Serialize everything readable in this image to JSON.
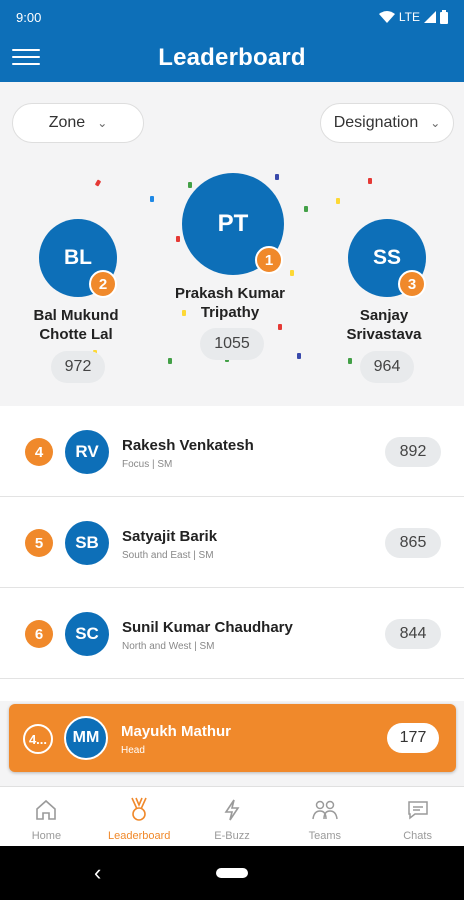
{
  "status_bar": {
    "time": "9:00",
    "network": "LTE"
  },
  "app_bar": {
    "title": "Leaderboard"
  },
  "filters": {
    "zone": "Zone",
    "designation": "Designation"
  },
  "podium": [
    {
      "rank": "1",
      "initials": "PT",
      "name_line1": "Prakash Kumar",
      "name_line2": "Tripathy",
      "score": "1055"
    },
    {
      "rank": "2",
      "initials": "BL",
      "name_line1": "Bal Mukund",
      "name_line2": "Chotte Lal",
      "score": "972"
    },
    {
      "rank": "3",
      "initials": "SS",
      "name_line1": "Sanjay",
      "name_line2": "Srivastava",
      "score": "964"
    }
  ],
  "list": [
    {
      "rank": "4",
      "initials": "RV",
      "name": "Rakesh Venkatesh",
      "sub": "Focus | SM",
      "score": "892"
    },
    {
      "rank": "5",
      "initials": "SB",
      "name": "Satyajit Barik",
      "sub": "South and East | SM",
      "score": "865"
    },
    {
      "rank": "6",
      "initials": "SC",
      "name": "Sunil Kumar Chaudhary",
      "sub": "North and West | SM",
      "score": "844"
    }
  ],
  "me": {
    "rank": "4...",
    "initials": "MM",
    "name": "Mayukh Mathur",
    "sub": "Head",
    "score": "177"
  },
  "bottom_nav": [
    {
      "label": "Home",
      "icon": "home-icon"
    },
    {
      "label": "Leaderboard",
      "icon": "medal-icon",
      "active": true
    },
    {
      "label": "E-Buzz",
      "icon": "bolt-icon"
    },
    {
      "label": "Teams",
      "icon": "team-icon"
    },
    {
      "label": "Chats",
      "icon": "chat-icon"
    }
  ],
  "colors": {
    "brand": "#0d6fb8",
    "accent": "#f0892b"
  }
}
